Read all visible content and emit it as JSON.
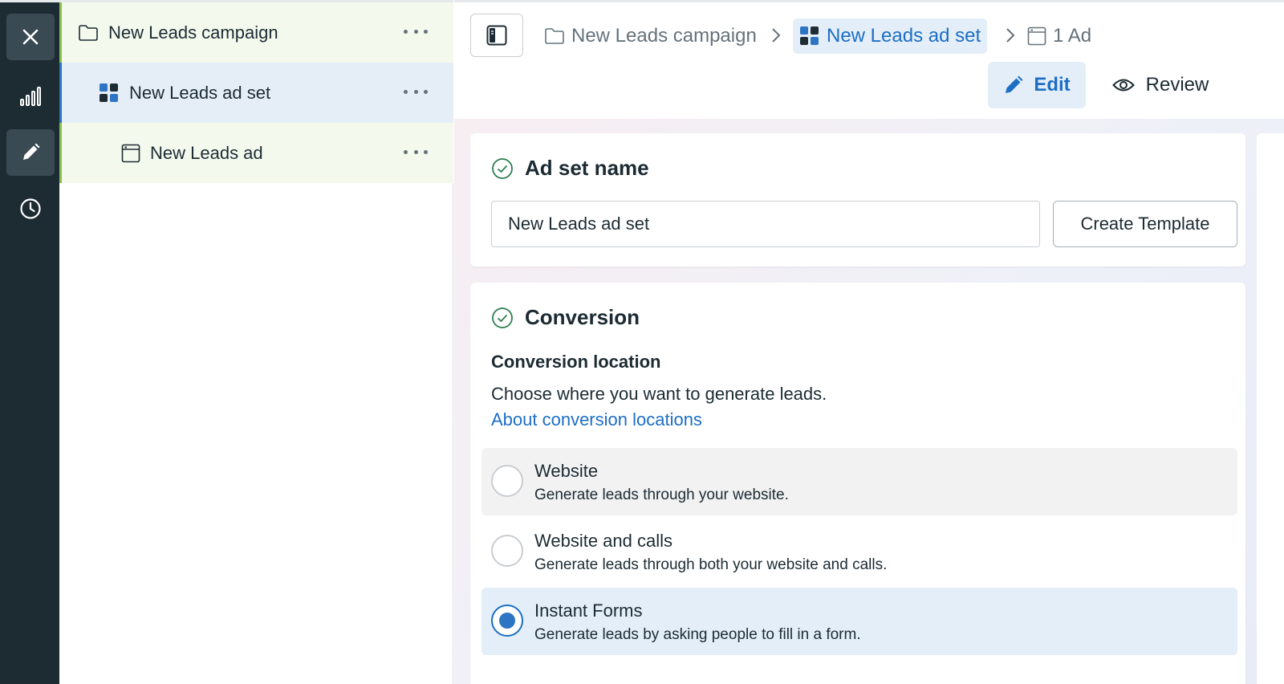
{
  "rail": {
    "items": [
      {
        "name": "close",
        "icon": "close-icon",
        "active": true
      },
      {
        "name": "reporting",
        "icon": "bar-chart-icon",
        "active": false
      },
      {
        "name": "edit",
        "icon": "pencil-icon",
        "active": true
      },
      {
        "name": "history",
        "icon": "clock-icon",
        "active": false
      }
    ]
  },
  "tree": {
    "campaign_label": "New Leads campaign",
    "adset_label": "New Leads ad set",
    "ad_label": "New Leads ad"
  },
  "header": {
    "breadcrumbs": {
      "campaign": "New Leads campaign",
      "adset": "New Leads ad set",
      "ad": "1 Ad"
    },
    "edit_label": "Edit",
    "review_label": "Review"
  },
  "adset_name_card": {
    "title": "Ad set name",
    "input_value": "New Leads ad set",
    "template_button": "Create Template"
  },
  "conversion_card": {
    "title": "Conversion",
    "subtitle": "Conversion location",
    "description": "Choose where you want to generate leads.",
    "link": "About conversion locations",
    "options": [
      {
        "title": "Website",
        "description": "Generate leads through your website.",
        "selected": false
      },
      {
        "title": "Website and calls",
        "description": "Generate leads through both your website and calls.",
        "selected": false
      },
      {
        "title": "Instant Forms",
        "description": "Generate leads by asking people to fill in a form.",
        "selected": true
      }
    ]
  },
  "colors": {
    "accent": "#1d6ec4",
    "rail_bg": "#1d2b33",
    "selected_bg": "#e3eef9",
    "campaign_marker": "#8bc34a",
    "success_green": "#2e7d52"
  }
}
